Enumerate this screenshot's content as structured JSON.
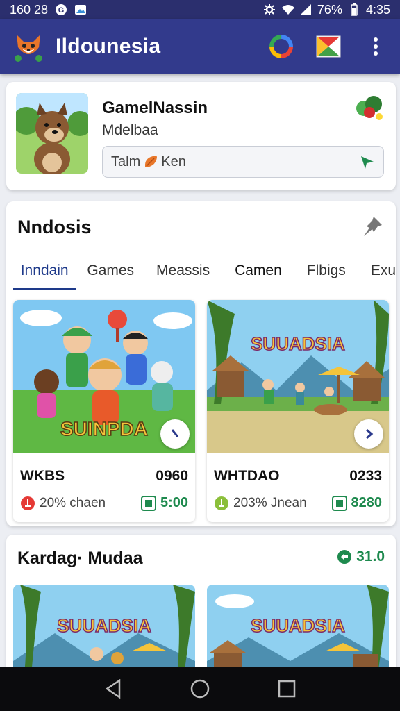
{
  "status_bar": {
    "left_text": "160 28",
    "battery_text": "76%",
    "time": "4:35"
  },
  "app_bar": {
    "title": "Ildounesia",
    "icons": [
      "fox-logo-icon",
      "google-icon",
      "flag-icon",
      "more-vert-icon"
    ]
  },
  "profile": {
    "name": "GamelNassin",
    "subtitle": "Mdelbaa",
    "field_before": "Talm",
    "field_after": "Ken"
  },
  "section": {
    "title": "Nndosis",
    "tabs": [
      {
        "label": "Inndain",
        "active": true
      },
      {
        "label": "Games",
        "active": false
      },
      {
        "label": "Meassis",
        "active": false
      },
      {
        "label": "Camen",
        "active": false
      },
      {
        "label": "Flbigs",
        "active": false
      },
      {
        "label": "Exu",
        "active": false
      }
    ],
    "cards": [
      {
        "banner": "SUINPDA",
        "title": "WKBS",
        "score": "0960",
        "meta": "20% chaen",
        "timer": "5:00"
      },
      {
        "banner": "SUUADSIA",
        "title": "WHTDAO",
        "score": "0233",
        "meta": "203% Jnean",
        "timer": "8280"
      }
    ]
  },
  "section2": {
    "title": "Kardag· Mudaa",
    "badge": "31.0",
    "banners": [
      "SUUADSIA",
      "SUUADSIA"
    ]
  },
  "colors": {
    "app_bar": "#323a8c",
    "status_bar": "#2b2f6e",
    "accent_green": "#1e8a4e",
    "tab_active": "#1e3a8a"
  }
}
